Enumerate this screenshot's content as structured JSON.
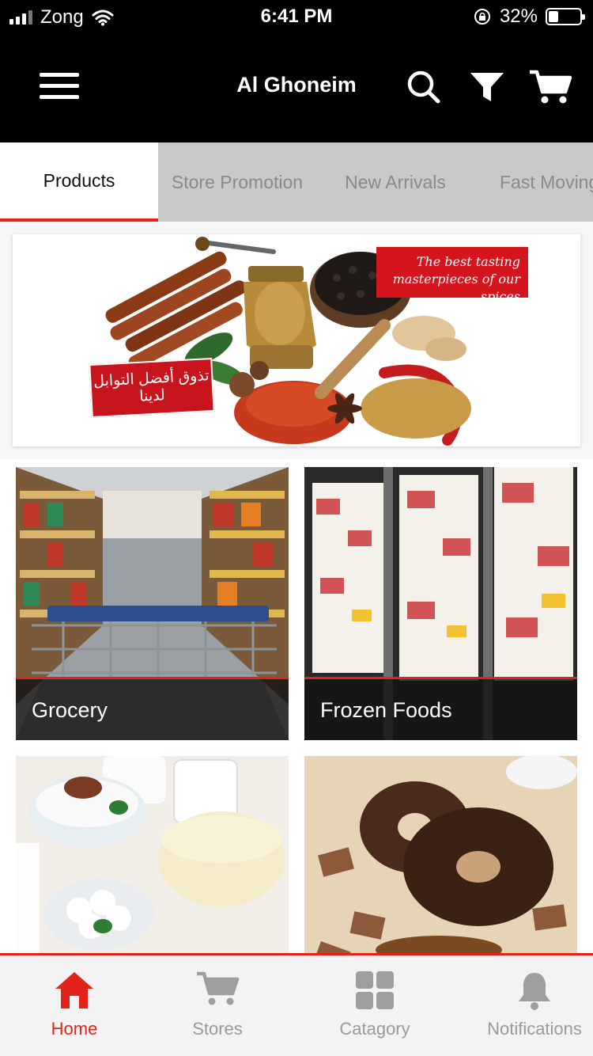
{
  "status_bar": {
    "carrier": "Zong",
    "time": "6:41 PM",
    "battery": "32%"
  },
  "header": {
    "title": "Al Ghoneim",
    "menu_icon": "hamburger-menu-icon",
    "search_icon": "search-icon",
    "filter_icon": "filter-icon",
    "cart_icon": "cart-icon"
  },
  "tabs": [
    {
      "label": "Products",
      "active": true
    },
    {
      "label": "Store Promotion",
      "active": false
    },
    {
      "label": "New Arrivals",
      "active": false
    },
    {
      "label": "Fast Moving",
      "active": false
    }
  ],
  "banner": {
    "english_text": "The best tasting masterpieces of our spices",
    "arabic_text": "تذوق أفضل التوابل لدينا"
  },
  "categories": [
    {
      "label": "Grocery"
    },
    {
      "label": "Frozen Foods"
    },
    {
      "label": ""
    },
    {
      "label": ""
    }
  ],
  "bottom_nav": [
    {
      "label": "Home",
      "icon": "home-icon",
      "active": true
    },
    {
      "label": "Stores",
      "icon": "cart-icon",
      "active": false
    },
    {
      "label": "Catagory",
      "icon": "grid-icon",
      "active": false
    },
    {
      "label": "Notifications",
      "icon": "bell-icon",
      "active": false
    }
  ],
  "colors": {
    "accent": "#e2231a",
    "header_bg": "#000000",
    "tab_bg": "#c9c9c9"
  }
}
